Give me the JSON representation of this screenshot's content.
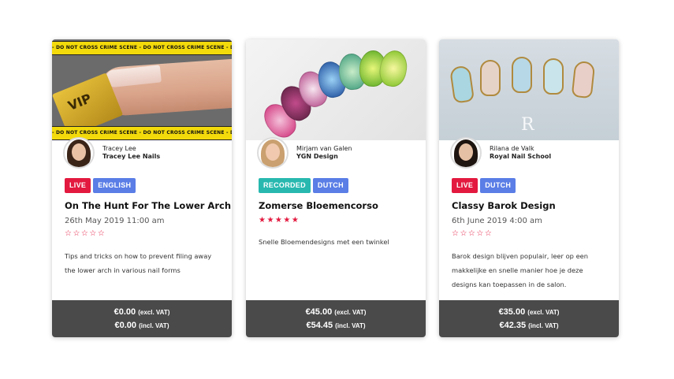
{
  "cards": [
    {
      "author_name": "Tracey Lee",
      "author_company": "Tracey Lee Nails",
      "badges": [
        "LIVE",
        "ENGLISH"
      ],
      "title": "On The Hunt For The Lower Arch",
      "date": "26th May 2019 11:00 am",
      "rating": 0,
      "stars": "☆☆☆☆☆",
      "description": "Tips and tricks on how to prevent filing away the lower arch in various nail forms",
      "price_excl": "€0.00",
      "price_excl_label": "(excl. VAT)",
      "price_incl": "€0.00",
      "price_incl_label": "(incl. VAT)",
      "image_text": {
        "tape": "- DO NOT CROSS   CRIME SCENE - DO NOT CROSS   CRIME SCENE - DO NOT CROSS   CRIME SCENE",
        "ticket": "VIP"
      }
    },
    {
      "author_name": "Mirjam van Galen",
      "author_company": "YGN Design",
      "badges": [
        "RECORDED",
        "DUTCH"
      ],
      "title": "Zomerse Bloemencorso",
      "date": "",
      "rating": 5,
      "stars": "★★★★★",
      "description": "Snelle Bloemendesigns met een twinkel",
      "price_excl": "€45.00",
      "price_excl_label": "(excl. VAT)",
      "price_incl": "€54.45",
      "price_incl_label": "(incl. VAT)"
    },
    {
      "author_name": "Rilana de Valk",
      "author_company": "Royal Nail School",
      "badges": [
        "LIVE",
        "DUTCH"
      ],
      "title": "Classy Barok Design",
      "date": "6th June 2019 4:00 am",
      "rating": 0,
      "stars": "☆☆☆☆☆",
      "description": "Barok design blijven populair, leer op een makkelijke en snelle manier hoe je deze designs kan toepassen in de salon.",
      "price_excl": "€35.00",
      "price_excl_label": "(excl. VAT)",
      "price_incl": "€42.35",
      "price_incl_label": "(incl. VAT)",
      "image_text": {
        "brand": "R"
      }
    }
  ],
  "colors": {
    "live": "#e3193f",
    "language": "#5a7de6",
    "recorded": "#28b8b0",
    "price_bar": "#4a4a4a",
    "star": "#e3193f"
  }
}
